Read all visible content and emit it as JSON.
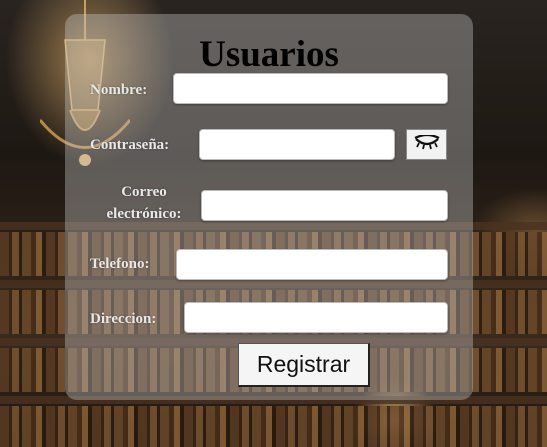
{
  "form": {
    "title": "Usuarios",
    "fields": {
      "nombre": {
        "label": "Nombre:",
        "value": ""
      },
      "contrasena": {
        "label": "Contraseña:",
        "value": "",
        "toggle_icon": "eye-closed-icon"
      },
      "correo": {
        "label_line1": "Correo",
        "label_line2": "electrónico:",
        "value": ""
      },
      "telefono": {
        "label": "Telefono:",
        "value": ""
      },
      "direccion": {
        "label": "Direccion:",
        "value": ""
      }
    },
    "submit_label": "Registrar"
  }
}
